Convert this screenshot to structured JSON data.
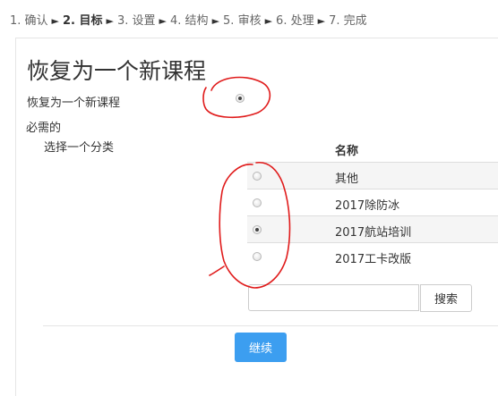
{
  "breadcrumb": {
    "steps": [
      "1. 确认",
      "2. 目标",
      "3. 设置",
      "4. 结构",
      "5. 审核",
      "6. 处理",
      "7. 完成"
    ],
    "separator": "►",
    "current_index": 1
  },
  "form": {
    "title": "恢复为一个新课程",
    "restore_option_label": "恢复为一个新课程",
    "restore_option_checked": true,
    "required_label": "必需的",
    "select_category_label": "选择一个分类",
    "table_header": "名称",
    "categories": [
      {
        "name": "其他",
        "checked": false
      },
      {
        "name": "2017除防冰",
        "checked": false
      },
      {
        "name": "2017航站培训",
        "checked": true
      },
      {
        "name": "2017工卡改版",
        "checked": false
      }
    ],
    "search_value": "",
    "search_button_label": "搜索",
    "continue_button_label": "继续"
  },
  "colors": {
    "primary_button": "#3c9ef0",
    "annotation_ink": "#e01b1b",
    "row_stripe": "#f5f5f5"
  }
}
